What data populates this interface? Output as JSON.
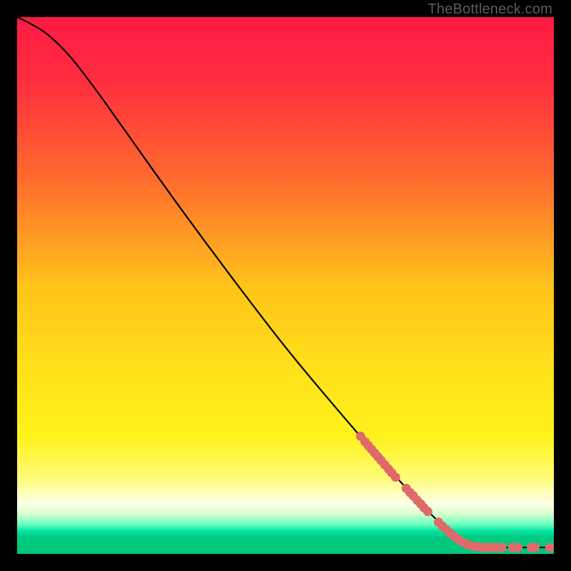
{
  "watermark": "TheBottleneck.com",
  "chart_data": {
    "type": "line",
    "title": "",
    "xlabel": "",
    "ylabel": "",
    "xlim": [
      0,
      100
    ],
    "ylim": [
      0,
      100
    ],
    "gradient_stops": [
      {
        "offset": 0.0,
        "color": "#ff1a44"
      },
      {
        "offset": 0.12,
        "color": "#ff2e3f"
      },
      {
        "offset": 0.3,
        "color": "#ff6a2e"
      },
      {
        "offset": 0.5,
        "color": "#ffc31a"
      },
      {
        "offset": 0.66,
        "color": "#ffe11a"
      },
      {
        "offset": 0.78,
        "color": "#fff21a"
      },
      {
        "offset": 0.86,
        "color": "#fffc7a"
      },
      {
        "offset": 0.905,
        "color": "#ffffe6"
      },
      {
        "offset": 0.925,
        "color": "#d8ffd2"
      },
      {
        "offset": 0.945,
        "color": "#6affc0"
      },
      {
        "offset": 0.958,
        "color": "#00e3a0"
      },
      {
        "offset": 0.97,
        "color": "#00c97f"
      },
      {
        "offset": 1.0,
        "color": "#00c97f"
      }
    ],
    "curve": [
      {
        "x": 0.0,
        "y": 100.0
      },
      {
        "x": 3.0,
        "y": 98.5
      },
      {
        "x": 6.0,
        "y": 96.5
      },
      {
        "x": 10.0,
        "y": 92.5
      },
      {
        "x": 15.0,
        "y": 86.0
      },
      {
        "x": 20.0,
        "y": 79.0
      },
      {
        "x": 30.0,
        "y": 65.0
      },
      {
        "x": 40.0,
        "y": 51.5
      },
      {
        "x": 50.0,
        "y": 38.5
      },
      {
        "x": 60.0,
        "y": 26.5
      },
      {
        "x": 70.0,
        "y": 15.0
      },
      {
        "x": 78.0,
        "y": 6.5
      },
      {
        "x": 83.0,
        "y": 2.2
      },
      {
        "x": 85.0,
        "y": 1.4
      },
      {
        "x": 88.0,
        "y": 1.2
      },
      {
        "x": 92.0,
        "y": 1.2
      },
      {
        "x": 96.0,
        "y": 1.2
      },
      {
        "x": 100.0,
        "y": 1.2
      }
    ],
    "highlight_points": [
      {
        "x": 64.0,
        "y": 21.9
      },
      {
        "x": 64.8,
        "y": 20.9
      },
      {
        "x": 65.4,
        "y": 20.2
      },
      {
        "x": 66.0,
        "y": 19.5
      },
      {
        "x": 66.6,
        "y": 18.8
      },
      {
        "x": 67.2,
        "y": 18.1
      },
      {
        "x": 67.8,
        "y": 17.4
      },
      {
        "x": 68.5,
        "y": 16.6
      },
      {
        "x": 69.2,
        "y": 15.8
      },
      {
        "x": 69.8,
        "y": 15.1
      },
      {
        "x": 70.5,
        "y": 14.3
      },
      {
        "x": 72.5,
        "y": 12.2
      },
      {
        "x": 73.2,
        "y": 11.4
      },
      {
        "x": 73.8,
        "y": 10.8
      },
      {
        "x": 74.5,
        "y": 10.0
      },
      {
        "x": 75.2,
        "y": 9.3
      },
      {
        "x": 75.8,
        "y": 8.6
      },
      {
        "x": 76.5,
        "y": 7.9
      },
      {
        "x": 78.5,
        "y": 5.9
      },
      {
        "x": 79.2,
        "y": 5.2
      },
      {
        "x": 80.0,
        "y": 4.5
      },
      {
        "x": 80.8,
        "y": 3.8
      },
      {
        "x": 81.5,
        "y": 3.2
      },
      {
        "x": 82.3,
        "y": 2.6
      },
      {
        "x": 83.0,
        "y": 2.2
      },
      {
        "x": 84.0,
        "y": 1.7
      },
      {
        "x": 85.0,
        "y": 1.4
      },
      {
        "x": 85.8,
        "y": 1.3
      },
      {
        "x": 86.5,
        "y": 1.2
      },
      {
        "x": 87.3,
        "y": 1.2
      },
      {
        "x": 88.0,
        "y": 1.2
      },
      {
        "x": 88.8,
        "y": 1.2
      },
      {
        "x": 89.5,
        "y": 1.2
      },
      {
        "x": 90.3,
        "y": 1.2
      },
      {
        "x": 92.3,
        "y": 1.2
      },
      {
        "x": 93.3,
        "y": 1.2
      },
      {
        "x": 95.8,
        "y": 1.2
      },
      {
        "x": 96.5,
        "y": 1.2
      },
      {
        "x": 99.2,
        "y": 1.2
      }
    ],
    "point_color": "#e06a6a",
    "point_radius": 6.5
  }
}
